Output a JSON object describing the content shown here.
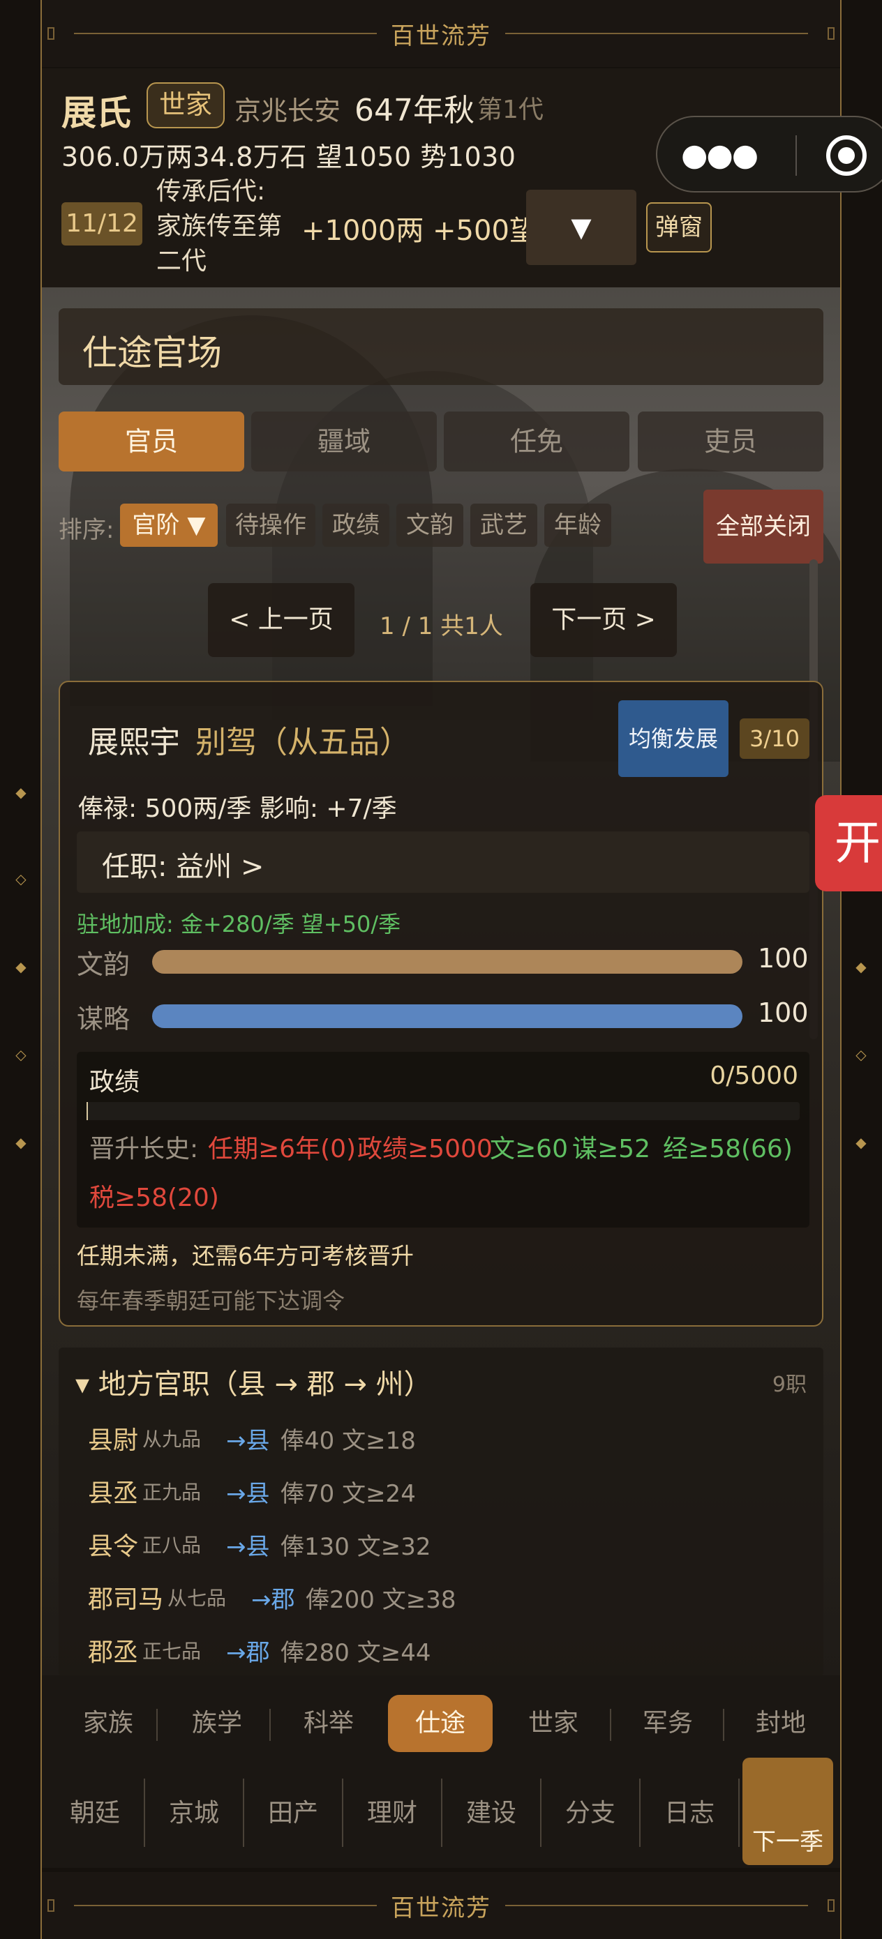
{
  "banner": {
    "title": "百世流芳"
  },
  "header": {
    "clan_name": "展氏",
    "clan_badge": "世家",
    "location": "京兆长安",
    "date": "647年秋",
    "generation": "第1代",
    "resources": "306.0万两34.8万石  望1050 势1030"
  },
  "inheritance": {
    "count": "11/12",
    "label": "传承后代:家族传至第二代",
    "bonus": "+1000两 +500望",
    "dropdown_icon": "▼",
    "popup_button": "弹窗"
  },
  "section": {
    "title": "仕途官场",
    "tabs": [
      "官员",
      "疆域",
      "任免",
      "吏员"
    ],
    "active_tab": 0
  },
  "sort": {
    "label": "排序:",
    "options": [
      "官阶 ▼",
      "待操作",
      "政绩",
      "文韵",
      "武艺",
      "年龄"
    ],
    "active": 0,
    "close_all": "全部关闭"
  },
  "pagination": {
    "prev": "< 上一页",
    "info": "1 / 1  共1人",
    "next": "下一页 >"
  },
  "official": {
    "name": "展熙宇",
    "rank": "别驾（从五品）",
    "strategy_button": "均衡发展",
    "fraction": "3/10",
    "salary": "俸禄: 500两/季   影响: +7/季",
    "post": "任职: 益州  >",
    "garrison_bonus": "驻地加成: 金+280/季  望+50/季",
    "attributes": [
      {
        "label": "文韵",
        "value": "100",
        "color": "#ad8659"
      },
      {
        "label": "谋略",
        "value": "100",
        "color": "#5b85c0"
      }
    ],
    "merit": {
      "label": "政绩",
      "value": "0/5000",
      "fraction": 0
    },
    "promotion": {
      "prefix": "晋升长史:",
      "items": [
        {
          "text": "任期≥6年(0)",
          "ok": false
        },
        {
          "text": "政绩≥5000",
          "ok": false
        },
        {
          "text": "文≥60",
          "ok": true
        },
        {
          "text": "谋≥52",
          "ok": true
        },
        {
          "text": "经≥58(66)",
          "ok": true
        },
        {
          "text": "税≥58(20)",
          "ok": false
        }
      ]
    },
    "note_tenure": "任期未满，还需6年方可考核晋升",
    "note_transfer": "每年春季朝廷可能下达调令"
  },
  "local_posts": {
    "title": "▾ 地方官职（县 → 郡 → 州）",
    "count": "9职",
    "rows": [
      {
        "name": "县尉",
        "grade": "从九品",
        "target": "→县",
        "desc": "俸40 文≥18"
      },
      {
        "name": "县丞",
        "grade": "正九品",
        "target": "→县",
        "desc": "俸70 文≥24"
      },
      {
        "name": "县令",
        "grade": "正八品",
        "target": "→县",
        "desc": "俸130 文≥32"
      },
      {
        "name": "郡司马",
        "grade": "从七品",
        "target": "→郡",
        "desc": "俸200 文≥38"
      },
      {
        "name": "郡丞",
        "grade": "正七品",
        "target": "→郡",
        "desc": "俸280 文≥44"
      }
    ]
  },
  "nav": {
    "primary": [
      "家族",
      "族学",
      "科举",
      "仕途",
      "世家",
      "军务",
      "封地"
    ],
    "active": 3,
    "secondary": [
      "朝廷",
      "京城",
      "田产",
      "理财",
      "建设",
      "分支",
      "日志"
    ],
    "next_season": "下一季"
  },
  "side_pill": "开",
  "capsule_icons": [
    "more-dots-icon",
    "target-icon"
  ],
  "colors": {
    "accent": "#b8732e",
    "gold": "#d4b26a",
    "ok": "#5fbf62",
    "fail": "#e0483c"
  }
}
